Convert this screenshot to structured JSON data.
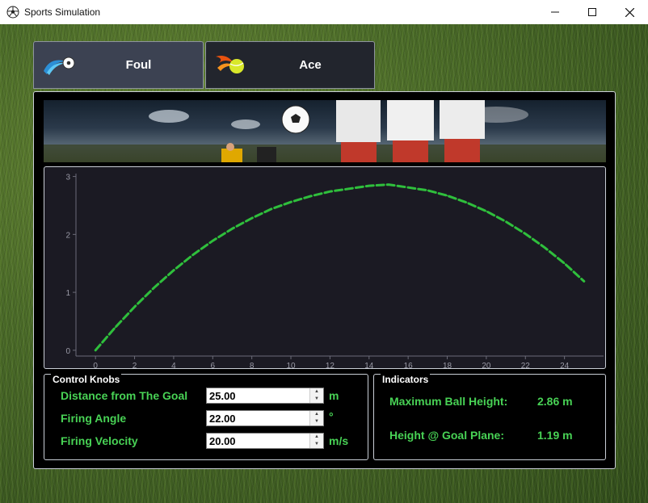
{
  "window": {
    "title": "Sports Simulation",
    "icon": "soccer-ball-icon",
    "controls": {
      "minimize_icon": "minimize-icon",
      "maximize_icon": "maximize-icon",
      "close_icon": "close-icon"
    }
  },
  "tabs": [
    {
      "label": "Foul",
      "icon": "comet-soccer-ball-icon",
      "selected": true
    },
    {
      "label": "Ace",
      "icon": "flaming-tennis-ball-icon",
      "selected": false
    }
  ],
  "banner": {
    "image": "stadium-soccer-players-banner"
  },
  "chart_data": {
    "type": "line",
    "title": "",
    "xlabel": "",
    "ylabel": "",
    "xlim": [
      -1,
      26
    ],
    "ylim": [
      -0.1,
      3.05
    ],
    "xticks": [
      0,
      2,
      4,
      6,
      8,
      10,
      12,
      14,
      16,
      18,
      20,
      22,
      24
    ],
    "yticks": [
      0,
      1,
      2,
      3
    ],
    "grid": false,
    "series": [
      {
        "color": "#2fbf3c",
        "style": "dashed",
        "x": [
          0,
          1,
          2,
          3,
          4,
          5,
          6,
          7,
          8,
          9,
          10,
          11,
          12,
          13,
          14,
          15,
          16,
          17,
          18,
          19,
          20,
          21,
          22,
          23,
          24,
          25
        ],
        "y": [
          0,
          0.39,
          0.75,
          1.08,
          1.38,
          1.65,
          1.89,
          2.1,
          2.28,
          2.44,
          2.56,
          2.66,
          2.74,
          2.79,
          2.84,
          2.86,
          2.81,
          2.76,
          2.67,
          2.55,
          2.4,
          2.22,
          2.01,
          1.77,
          1.5,
          1.19
        ]
      }
    ]
  },
  "controls": {
    "title": "Control Knobs",
    "fields": [
      {
        "label": "Distance from The Goal",
        "value": "25.00",
        "unit": "m"
      },
      {
        "label": "Firing Angle",
        "value": "22.00",
        "unit": "°"
      },
      {
        "label": "Firing Velocity",
        "value": "20.00",
        "unit": "m/s"
      }
    ]
  },
  "indicators": {
    "title": "Indicators",
    "max_height_label": "Maximum Ball Height:",
    "max_height_value": "2.86 m",
    "goal_height_label": "Height @ Goal Plane:",
    "goal_height_value": "1.19 m"
  },
  "colors": {
    "accent_green": "#48d255",
    "line_green": "#2fbf3c",
    "panel_bg": "#000000",
    "chart_bg": "#1b1a23"
  }
}
